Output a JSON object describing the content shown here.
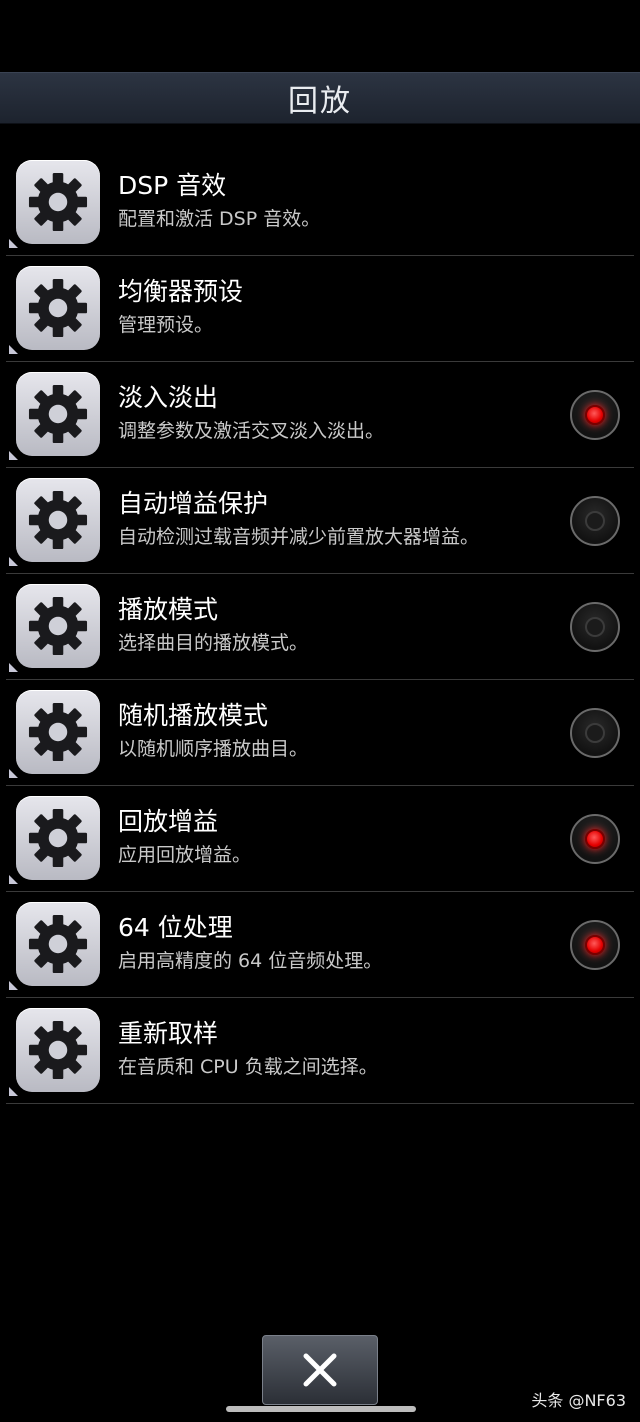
{
  "header": {
    "title": "回放"
  },
  "items": [
    {
      "title": "DSP 音效",
      "subtitle": "配置和激活 DSP 音效。",
      "toggle": null
    },
    {
      "title": "均衡器预设",
      "subtitle": "管理预设。",
      "toggle": null
    },
    {
      "title": "淡入淡出",
      "subtitle": "调整参数及激活交叉淡入淡出。",
      "toggle": "on"
    },
    {
      "title": "自动增益保护",
      "subtitle": "自动检测过载音频并减少前置放大器增益。",
      "toggle": "off"
    },
    {
      "title": "播放模式",
      "subtitle": "选择曲目的播放模式。",
      "toggle": "off"
    },
    {
      "title": "随机播放模式",
      "subtitle": "以随机顺序播放曲目。",
      "toggle": "off"
    },
    {
      "title": "回放增益",
      "subtitle": "应用回放增益。",
      "toggle": "on"
    },
    {
      "title": "64 位处理",
      "subtitle": "启用高精度的 64 位音频处理。",
      "toggle": "on"
    },
    {
      "title": "重新取样",
      "subtitle": "在音质和 CPU 负载之间选择。",
      "toggle": null
    }
  ],
  "footer": {
    "close_icon": "close-icon"
  },
  "watermark": "头条 @NF63",
  "colors": {
    "led_on": "#e40000",
    "background": "#000000",
    "header": "#262d39"
  }
}
